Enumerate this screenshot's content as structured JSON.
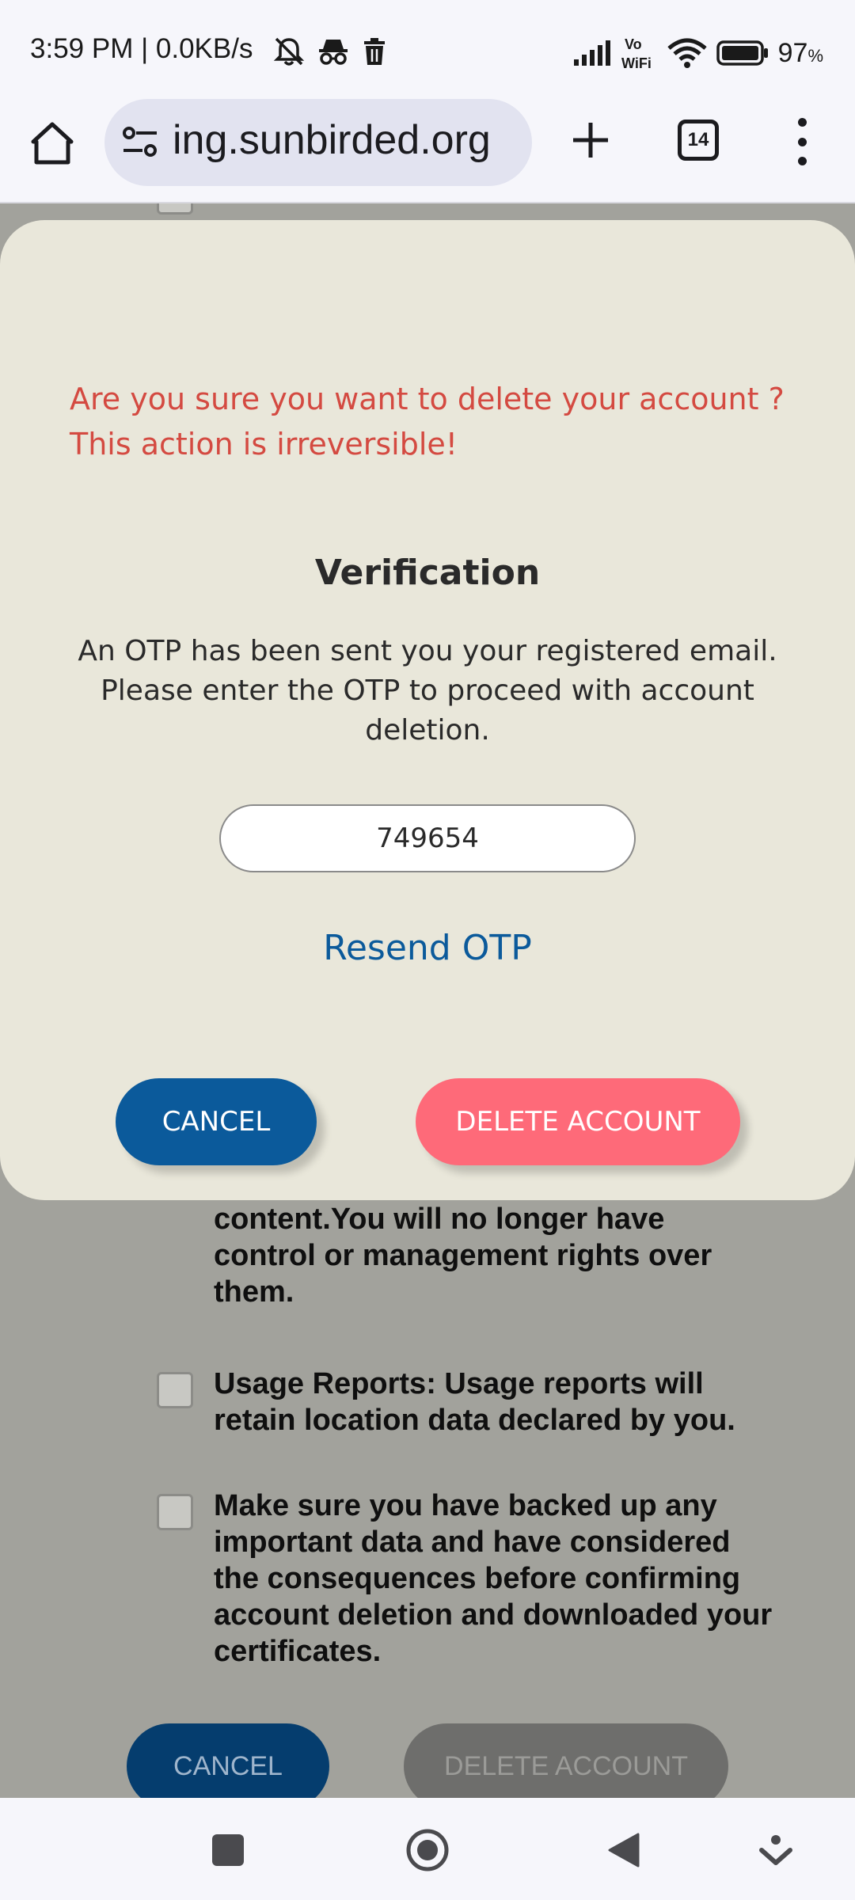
{
  "status_bar": {
    "time_speed": "3:59 PM | 0.0KB/s",
    "battery": "97",
    "battery_unit": "%",
    "vowifi_top": "Vo",
    "vowifi_bottom": "WiFi",
    "icons": [
      "mute-icon",
      "incognito-icon",
      "trash-icon",
      "signal-icon",
      "vowifi-icon",
      "wifi-icon",
      "battery-icon"
    ]
  },
  "browser": {
    "url": "ing.sunbirded.org",
    "tab_count": "14"
  },
  "background": {
    "items": [
      {
        "text": "content.You will no longer have control or management rights over them."
      },
      {
        "text": "Usage Reports: Usage reports will retain location data declared by you."
      },
      {
        "text": "Make sure you have backed up any important data and have considered the consequences before confirming account deletion and downloaded your certificates."
      }
    ],
    "cancel_label": "CANCEL",
    "delete_label": "DELETE ACCOUNT"
  },
  "modal": {
    "warning_line1": "Are you sure you want to delete your account ?",
    "warning_line2": "This action is irreversible!",
    "title": "Verification",
    "description": "An OTP has been sent you your registered email. Please enter the OTP to proceed with account deletion.",
    "otp_value": "749654",
    "resend_label": "Resend OTP",
    "cancel_label": "CANCEL",
    "delete_label": "DELETE ACCOUNT"
  },
  "colors": {
    "modal_bg": "#e9e7da",
    "warning": "#d44a41",
    "primary": "#0b5a9b",
    "danger": "#fe6a79"
  }
}
